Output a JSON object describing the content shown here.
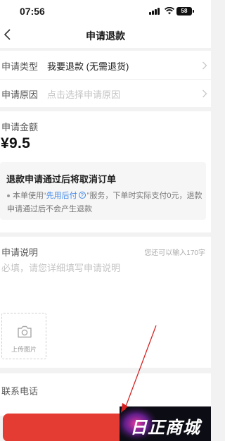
{
  "status_bar": {
    "time": "07:56",
    "battery": "58"
  },
  "nav": {
    "title": "申请退款"
  },
  "form": {
    "type_label": "申请类型",
    "type_value": "我要退款 (无需退货)",
    "reason_label": "申请原因",
    "reason_placeholder": "点击选择申请原因"
  },
  "amount": {
    "label": "申请金额",
    "value": "¥9.5"
  },
  "notice": {
    "title": "退款申请通过后将取消订单",
    "text_prefix": "本单使用“",
    "text_link": "先用后付",
    "help_icon": "?",
    "text_suffix": "”服务，下单时实际支付0元，退款申请通过后不会产生退款"
  },
  "description": {
    "label": "申请说明",
    "counter": "您还可以输入170字",
    "placeholder": "必填，请您详细填写申请说明"
  },
  "upload": {
    "label": "上传图片",
    "icon": "camera-icon"
  },
  "phone": {
    "label": "联系电话"
  },
  "watermark": {
    "text": "日正商城"
  },
  "colors": {
    "accent": "#e43c32",
    "link": "#3c86e8",
    "annotation": "#d42020"
  }
}
